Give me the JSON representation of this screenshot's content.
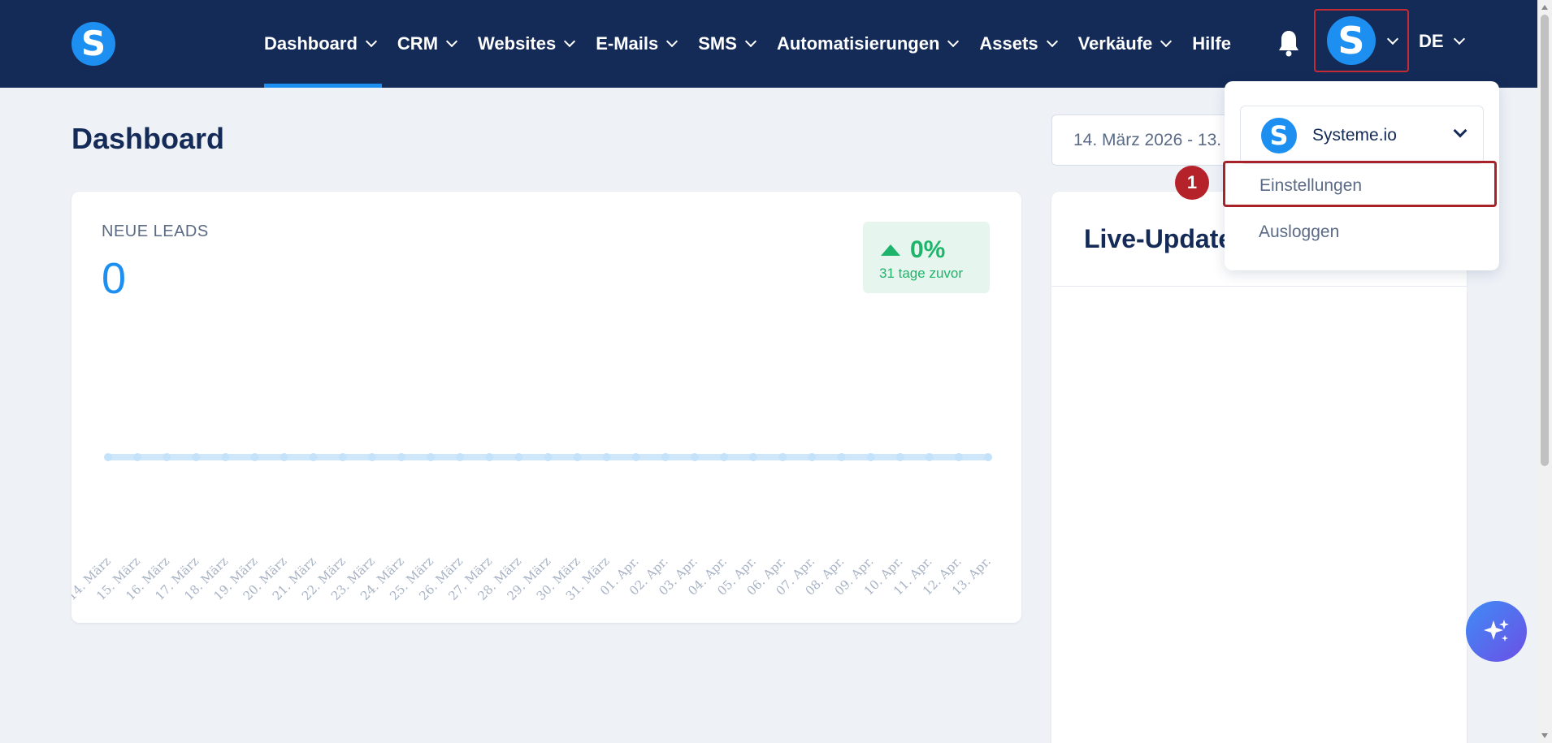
{
  "brand": {
    "logo_letter": "S"
  },
  "nav": {
    "items": [
      {
        "label": "Dashboard",
        "has_dropdown": true,
        "active": true
      },
      {
        "label": "CRM",
        "has_dropdown": true
      },
      {
        "label": "Websites",
        "has_dropdown": true
      },
      {
        "label": "E-Mails",
        "has_dropdown": true
      },
      {
        "label": "SMS",
        "has_dropdown": true
      },
      {
        "label": "Automatisierungen",
        "has_dropdown": true
      },
      {
        "label": "Assets",
        "has_dropdown": true
      },
      {
        "label": "Verkäufe",
        "has_dropdown": true
      },
      {
        "label": "Hilfe",
        "has_dropdown": false
      }
    ],
    "avatar_letter": "S",
    "language": "DE"
  },
  "page": {
    "title": "Dashboard",
    "date_range": "14. März 2026 - 13. Apr. 2026"
  },
  "leads_card": {
    "label": "NEUE LEADS",
    "value": "0",
    "change_pct": "0%",
    "change_caption": "31 tage zuvor"
  },
  "chart_data": {
    "type": "line",
    "x": [
      "14. März",
      "15. März",
      "16. März",
      "17. März",
      "18. März",
      "19. März",
      "20. März",
      "21. März",
      "22. März",
      "23. März",
      "24. März",
      "25. März",
      "26. März",
      "27. März",
      "28. März",
      "29. März",
      "30. März",
      "31. März",
      "01. Apr.",
      "02. Apr.",
      "03. Apr.",
      "04. Apr.",
      "05. Apr.",
      "06. Apr.",
      "07. Apr.",
      "08. Apr.",
      "09. Apr.",
      "10. Apr.",
      "11. Apr.",
      "12. Apr.",
      "13. Apr."
    ],
    "series": [
      {
        "values": [
          0,
          0,
          0,
          0,
          0,
          0,
          0,
          0,
          0,
          0,
          0,
          0,
          0,
          0,
          0,
          0,
          0,
          0,
          0,
          0,
          0,
          0,
          0,
          0,
          0,
          0,
          0,
          0,
          0,
          0,
          0
        ]
      }
    ],
    "grid": false,
    "color": "#cfe7fb"
  },
  "live_card": {
    "title": "Live-Updates"
  },
  "account_menu": {
    "account_name": "Systeme.io",
    "settings_label": "Einstellungen",
    "logout_label": "Ausloggen",
    "step_number": "1"
  },
  "colors": {
    "navy": "#142a57",
    "accent": "#1d8ff0",
    "success": "#1fb46b",
    "highlight": "#a8222a"
  }
}
